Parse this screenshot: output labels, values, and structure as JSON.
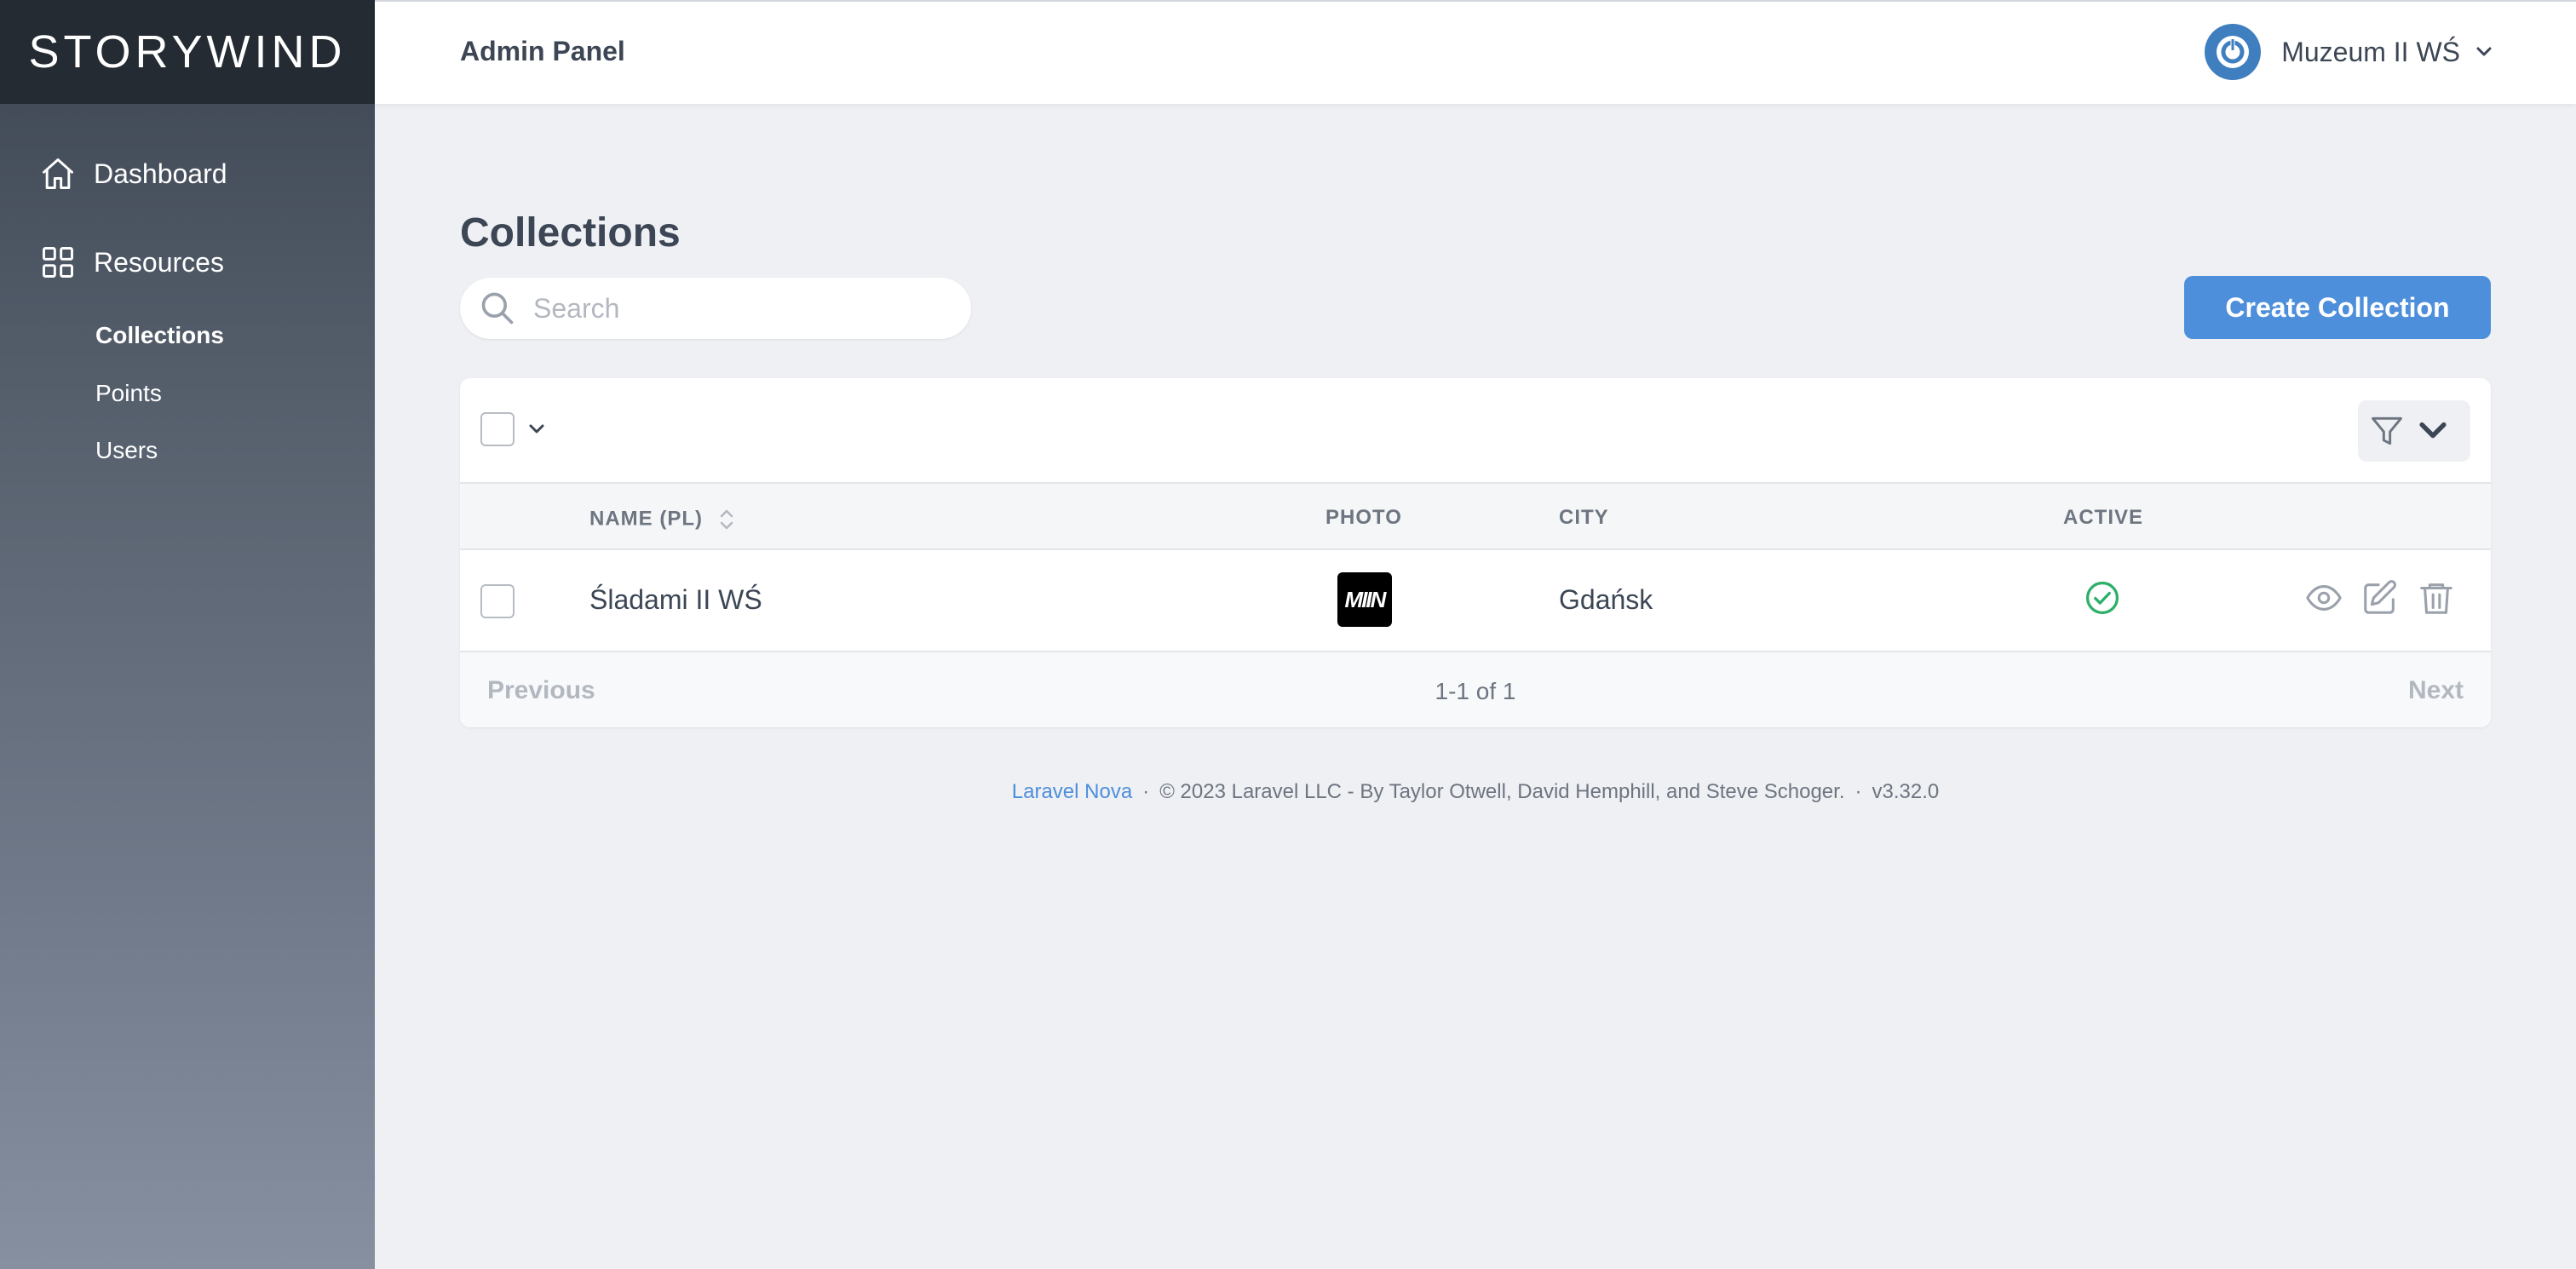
{
  "brand": {
    "name": "STORYWIND"
  },
  "header": {
    "title": "Admin Panel",
    "user": "Muzeum II WŚ"
  },
  "sidebar": {
    "dashboard": "Dashboard",
    "resources": "Resources",
    "items": [
      {
        "label": "Collections",
        "active": true
      },
      {
        "label": "Points",
        "active": false
      },
      {
        "label": "Users",
        "active": false
      }
    ]
  },
  "main": {
    "title": "Collections",
    "search_placeholder": "Search",
    "create_label": "Create Collection",
    "columns": {
      "name": "NAME (PL)",
      "photo": "PHOTO",
      "city": "CITY",
      "active": "ACTIVE"
    },
    "rows": [
      {
        "name": "Śladami II WŚ",
        "photo_logo": "MIIN",
        "city": "Gdańsk",
        "active": true
      }
    ],
    "pagination": {
      "previous": "Previous",
      "info": "1-1 of 1",
      "next": "Next"
    }
  },
  "footer": {
    "link": "Laravel Nova",
    "separator": "·",
    "copyright": "© 2023 Laravel LLC - By Taylor Otwell, David Hemphill, and Steve Schoger.",
    "version": "v3.32.0"
  },
  "colors": {
    "accent": "#4d8fdb",
    "success": "#2eaf6a",
    "sidebar_top": "#252b33"
  }
}
